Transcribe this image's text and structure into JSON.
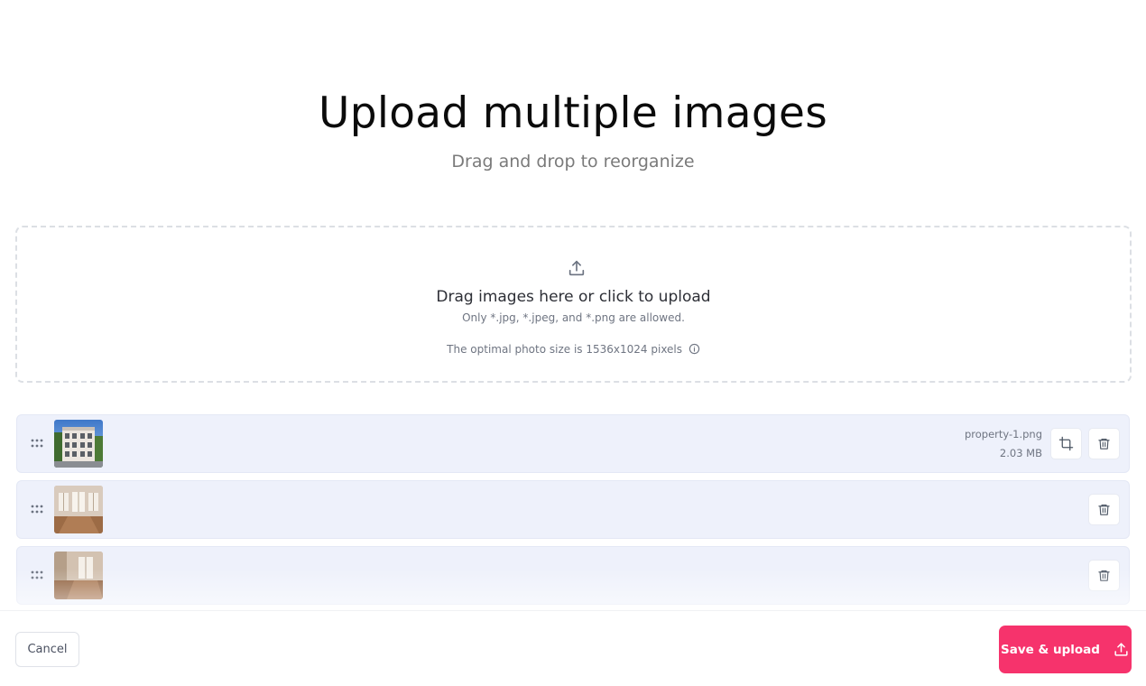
{
  "header": {
    "title": "Upload multiple images",
    "subtitle": "Drag and drop to reorganize"
  },
  "dropzone": {
    "icon": "upload-icon",
    "main_text": "Drag images here or click to upload",
    "allowed_text": "Only *.jpg, *.jpeg, and *.png are allowed.",
    "optimal_text": "The optimal photo size is 1536x1024 pixels",
    "info_icon": "info-icon"
  },
  "images": [
    {
      "thumbnail": "building-exterior",
      "filename": "property-1.png",
      "size": "2.03 MB",
      "has_crop": true
    },
    {
      "thumbnail": "empty-room-windows",
      "filename": "",
      "size": "",
      "has_crop": false
    },
    {
      "thumbnail": "empty-room-floor",
      "filename": "",
      "size": "",
      "has_crop": false
    }
  ],
  "footer": {
    "cancel_label": "Cancel",
    "save_label": "Save & upload",
    "save_icon": "upload-icon"
  },
  "colors": {
    "accent": "#f6336c",
    "row_background": "#eef1fb",
    "muted_text": "#6f7582"
  }
}
